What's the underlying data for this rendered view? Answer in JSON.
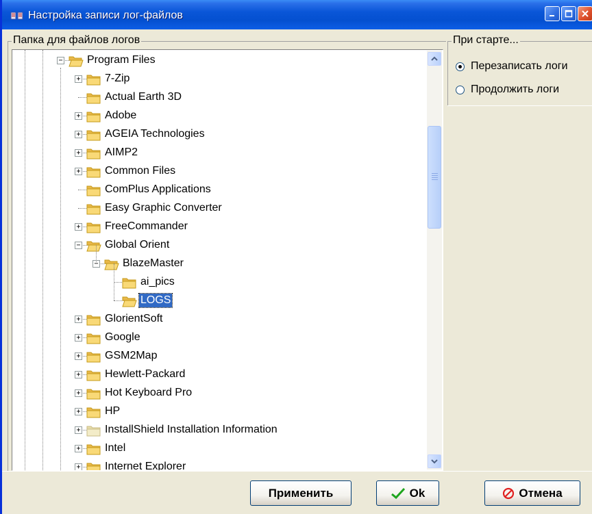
{
  "window": {
    "title": "Настройка записи лог-файлов"
  },
  "folders_group": {
    "label": "Папка для файлов логов"
  },
  "tree": {
    "items": [
      {
        "label": "Program Files",
        "state": "expanded"
      },
      {
        "label": "7-Zip",
        "state": "collapsed"
      },
      {
        "label": "Actual Earth 3D",
        "state": "leaf"
      },
      {
        "label": "Adobe",
        "state": "collapsed"
      },
      {
        "label": "AGEIA Technologies",
        "state": "collapsed"
      },
      {
        "label": "AIMP2",
        "state": "collapsed"
      },
      {
        "label": "Common Files",
        "state": "collapsed"
      },
      {
        "label": "ComPlus Applications",
        "state": "leaf"
      },
      {
        "label": "Easy Graphic Converter",
        "state": "leaf"
      },
      {
        "label": "FreeCommander",
        "state": "collapsed"
      },
      {
        "label": "Global Orient",
        "state": "expanded"
      },
      {
        "label": "BlazeMaster",
        "state": "expanded"
      },
      {
        "label": "ai_pics",
        "state": "leaf"
      },
      {
        "label": "LOGS",
        "state": "leaf",
        "selected": true
      },
      {
        "label": "GlorientSoft",
        "state": "collapsed"
      },
      {
        "label": "Google",
        "state": "collapsed"
      },
      {
        "label": "GSM2Map",
        "state": "collapsed"
      },
      {
        "label": "Hewlett-Packard",
        "state": "collapsed"
      },
      {
        "label": "Hot Keyboard Pro",
        "state": "collapsed"
      },
      {
        "label": "HP",
        "state": "collapsed"
      },
      {
        "label": "InstallShield Installation Information",
        "state": "collapsed",
        "hidden_folder": true
      },
      {
        "label": "Intel",
        "state": "collapsed"
      },
      {
        "label": "Internet Explorer",
        "state": "collapsed"
      }
    ]
  },
  "startup_group": {
    "label": "При старте...",
    "options": [
      {
        "label": "Перезаписать логи",
        "checked": true
      },
      {
        "label": "Продолжить логи",
        "checked": false
      }
    ]
  },
  "buttons": {
    "apply": "Применить",
    "ok": "Ok",
    "cancel": "Отмена"
  },
  "colors": {
    "titlebar": "#0a56d8",
    "selection": "#316ac5",
    "ok_check": "#1ea51e",
    "cancel_icon": "#e02020"
  }
}
